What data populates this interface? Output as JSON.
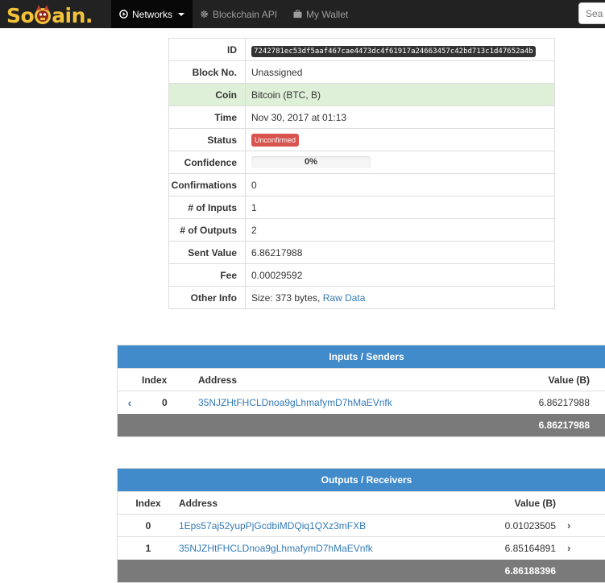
{
  "navbar": {
    "brand": {
      "left": "So",
      "right": "ain."
    },
    "items": [
      {
        "label": "Networks",
        "icon": "play-circle-icon",
        "active": true
      },
      {
        "label": "Blockchain API",
        "icon": "gear-icon"
      },
      {
        "label": "My Wallet",
        "icon": "briefcase-icon"
      }
    ],
    "search_placeholder": "Sea"
  },
  "tx": {
    "rows": [
      {
        "label": "ID",
        "value": "7242781ec53df5aaf467cae4473dc4f61917a24663457c42bd713c1d47652a4b"
      },
      {
        "label": "Block No.",
        "value": "Unassigned"
      },
      {
        "label": "Coin",
        "value": "Bitcoin (BTC, B)"
      },
      {
        "label": "Time",
        "value": "Nov 30, 2017 at 01:13"
      },
      {
        "label": "Status",
        "value": "Unconfirmed"
      },
      {
        "label": "Confidence",
        "value": "0%",
        "progress": 0
      },
      {
        "label": "Confirmations",
        "value": "0"
      },
      {
        "label": "# of Inputs",
        "value": "1"
      },
      {
        "label": "# of Outputs",
        "value": "2"
      },
      {
        "label": "Sent Value",
        "value": "6.86217988"
      },
      {
        "label": "Fee",
        "value": "0.00029592"
      },
      {
        "label": "Other Info",
        "value": "Size: 373 bytes,",
        "link": "Raw Data"
      }
    ],
    "colors": {
      "success_row": "#dff0d8",
      "danger": "#d9534f"
    }
  },
  "inputs": {
    "title": "Inputs / Senders",
    "headers": {
      "index": "Index",
      "address": "Address",
      "value": "Value (B)"
    },
    "rows": [
      {
        "index": "0",
        "address": "35NJZHtFHCLDnoa9gLhmafymD7hMaEVnfk",
        "value": "6.86217988"
      }
    ],
    "total": "6.86217988"
  },
  "outputs": {
    "title": "Outputs / Receivers",
    "headers": {
      "index": "Index",
      "address": "Address",
      "value": "Value (B)"
    },
    "rows": [
      {
        "index": "0",
        "address": "1Eps57aj52yupPjGcdbiMDQiq1QXz3mFXB",
        "value": "0.01023505"
      },
      {
        "index": "1",
        "address": "35NJZHtFHCLDnoa9gLhmafymD7hMaEVnfk",
        "value": "6.85164891"
      }
    ],
    "total": "6.86188396"
  },
  "glyphs": {
    "chevron_left": "‹",
    "chevron_right": "›"
  }
}
